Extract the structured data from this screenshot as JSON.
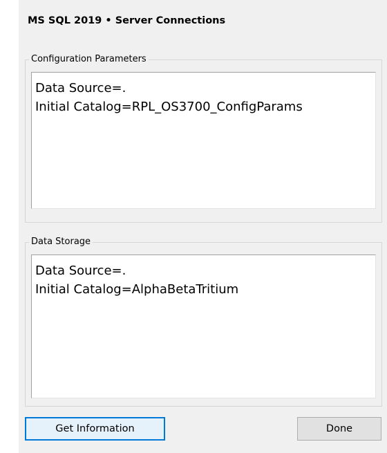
{
  "window": {
    "title": "MS SQL 2019 • Server Connections"
  },
  "config_group": {
    "legend": "Configuration Parameters",
    "lines": [
      "Data Source=.",
      "Initial Catalog=RPL_OS3700_ConfigParams"
    ]
  },
  "storage_group": {
    "legend": "Data Storage",
    "lines": [
      "Data Source=.",
      "Initial Catalog=AlphaBetaTritium"
    ]
  },
  "buttons": {
    "get_information": "Get Information",
    "done": "Done"
  }
}
